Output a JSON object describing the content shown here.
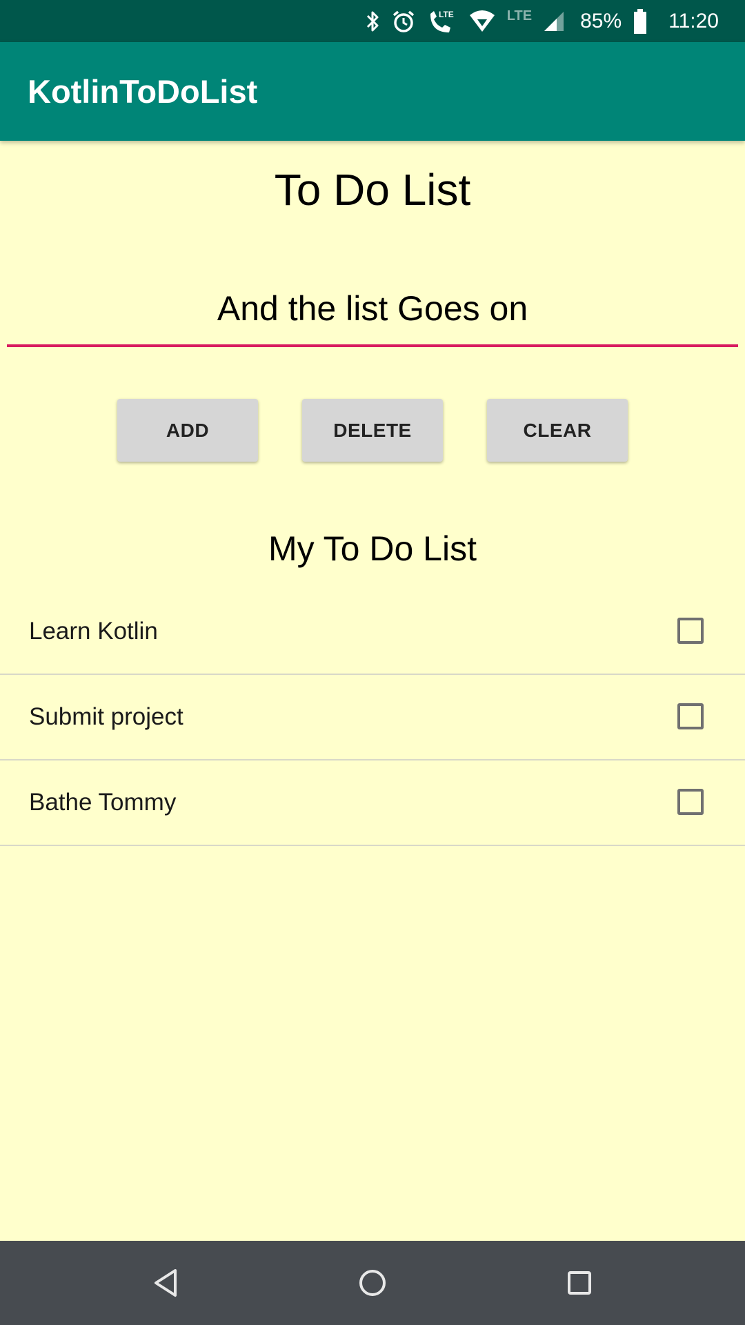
{
  "status_bar": {
    "battery_percent": "85%",
    "time": "11:20",
    "icons": [
      "bluetooth-icon",
      "alarm-icon",
      "lte-call-icon",
      "wifi-icon",
      "lte-icon",
      "signal-icon",
      "battery-icon"
    ],
    "lte_label": "LTE"
  },
  "app_bar": {
    "title": "KotlinToDoList"
  },
  "main": {
    "title": "To Do List",
    "input": {
      "value": "And the list Goes on"
    },
    "buttons": {
      "add": "ADD",
      "delete": "DELETE",
      "clear": "CLEAR"
    },
    "list_heading": "My To Do List",
    "items": [
      {
        "label": "Learn Kotlin",
        "checked": false
      },
      {
        "label": "Submit project",
        "checked": false
      },
      {
        "label": "Bathe Tommy",
        "checked": false
      }
    ]
  },
  "nav_bar": {
    "icons": [
      "back-icon",
      "home-icon",
      "recents-icon"
    ]
  },
  "colors": {
    "status_bar": "#00574B",
    "app_bar": "#008577",
    "background": "#FFFFCC",
    "input_underline": "#D81B60",
    "button": "#D6D6D6",
    "nav_bar": "#474B50"
  }
}
